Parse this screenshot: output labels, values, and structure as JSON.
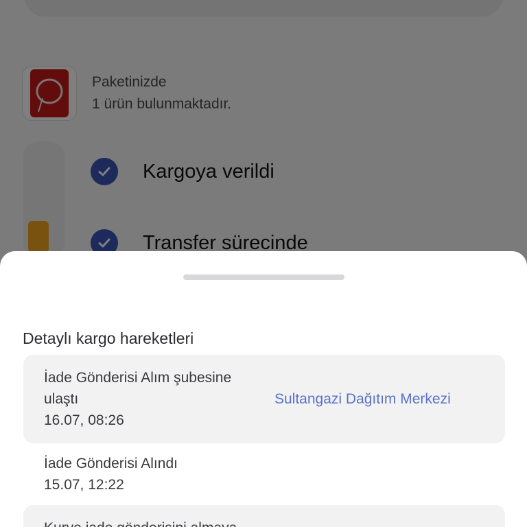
{
  "package": {
    "line1": "Paketinizde",
    "line2": "1 ürün bulunmaktadır."
  },
  "steps": [
    {
      "label": "Kargoya verildi"
    },
    {
      "label": "Transfer sürecinde"
    }
  ],
  "sheet": {
    "title": "Detaylı kargo hareketleri",
    "movements": [
      {
        "event": "İade Gönderisi Alım şubesine ulaştı",
        "date": "16.07, 08:26",
        "location": "Sultangazi Dağıtım Merkezi"
      },
      {
        "event": "İade Gönderisi Alındı",
        "date": "15.07, 12:22"
      },
      {
        "event": "Kurye iade gönderisini almaya"
      }
    ]
  },
  "colors": {
    "accent": "#3a56b8",
    "link": "#5a72c8"
  },
  "icons": {
    "step_status": "check-icon",
    "product": "product-thumbnail"
  }
}
